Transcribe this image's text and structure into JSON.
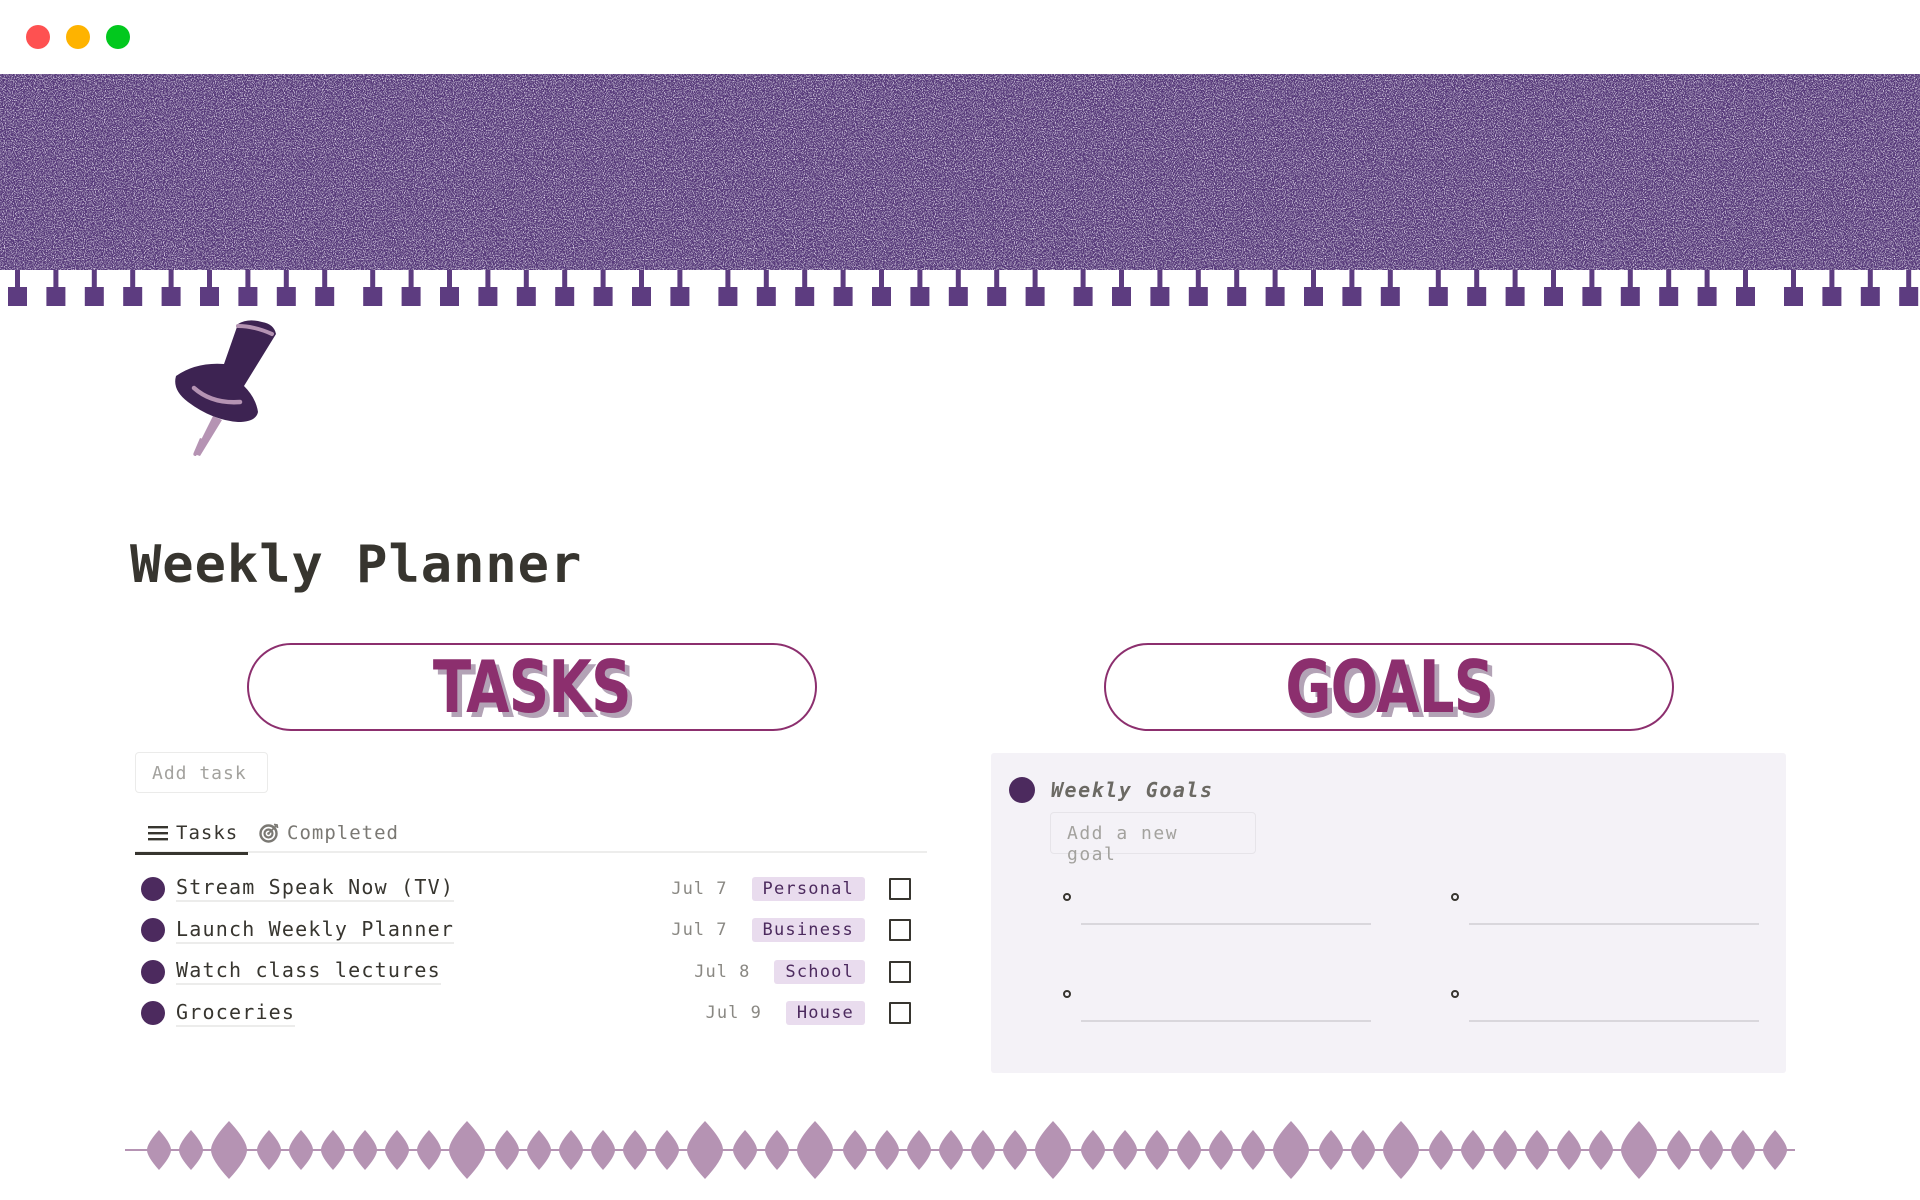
{
  "window": {
    "controls": [
      "close",
      "minimize",
      "maximize"
    ],
    "colors": {
      "close": "#fe5151",
      "minimize": "#feb300",
      "maximize": "#02c81e"
    }
  },
  "cover": {
    "description": "purple glitter banner with tassel fringe"
  },
  "page": {
    "icon": "pushpin-icon",
    "title": "Weekly Planner"
  },
  "tasks_section": {
    "header": "TASKS",
    "add_button": "Add task",
    "tabs": [
      {
        "label": "Tasks",
        "icon": "list-icon",
        "active": true
      },
      {
        "label": "Completed",
        "icon": "target-icon",
        "active": false
      }
    ],
    "items": [
      {
        "name": "Stream Speak Now (TV)",
        "date": "Jul 7",
        "tag": "Personal",
        "done": false
      },
      {
        "name": "Launch Weekly Planner",
        "date": "Jul 7",
        "tag": "Business",
        "done": false
      },
      {
        "name": "Watch class lectures",
        "date": "Jul 8",
        "tag": "School",
        "done": false
      },
      {
        "name": "Groceries",
        "date": "Jul 9",
        "tag": "House",
        "done": false
      }
    ]
  },
  "goals_section": {
    "header": "GOALS",
    "panel_title": "Weekly Goals",
    "add_button": "Add a new goal",
    "goals": [
      "",
      "",
      "",
      ""
    ]
  },
  "colors": {
    "accent": "#8c2f6e",
    "dot": "#4c2a5e",
    "tag_bg": "#e9dcee",
    "panel_bg": "#f4f2f7",
    "divider": "#b593b3"
  }
}
